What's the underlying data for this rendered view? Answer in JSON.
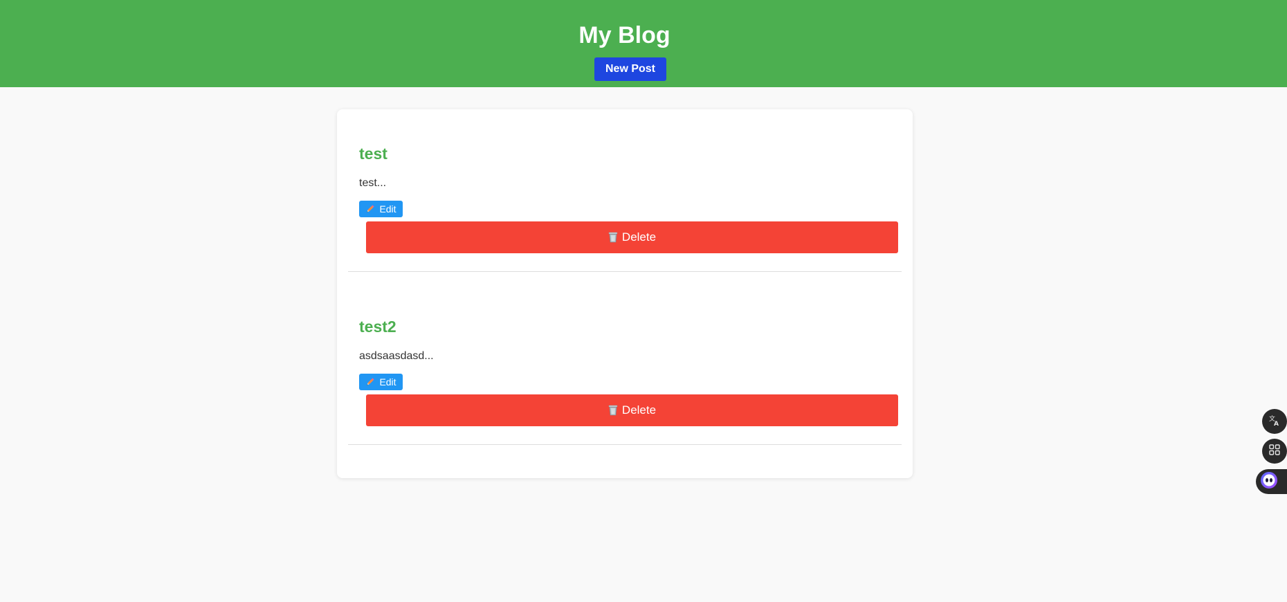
{
  "header": {
    "title": "My Blog",
    "new_post_label": "New Post",
    "background_color": "#4caf50",
    "new_post_color": "#1e46e0"
  },
  "posts": [
    {
      "title": "test",
      "excerpt": "test...",
      "edit_label": "Edit",
      "delete_label": "Delete"
    },
    {
      "title": "test2",
      "excerpt": "asdsaasdasd...",
      "edit_label": "Edit",
      "delete_label": "Delete"
    }
  ],
  "icons": {
    "edit": "pencil-icon",
    "delete": "wastebasket-icon",
    "floating": [
      "translate-icon",
      "apps-grid-icon",
      "assistant-bot-icon"
    ]
  },
  "colors": {
    "post_title": "#4caf50",
    "edit_button": "#2196f3",
    "delete_button": "#f44336",
    "page_background": "#f9f9f9"
  }
}
